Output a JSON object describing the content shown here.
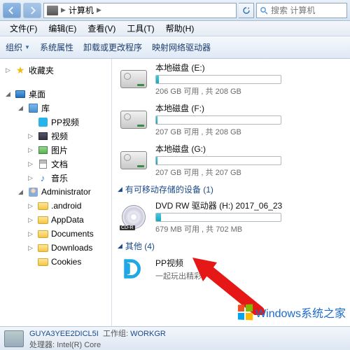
{
  "addressbar": {
    "location": "计算机",
    "sep": "▶"
  },
  "search": {
    "placeholder": "搜索 计算机"
  },
  "menu": {
    "file": "文件(F)",
    "edit": "编辑(E)",
    "view": "查看(V)",
    "tools": "工具(T)",
    "help": "帮助(H)"
  },
  "toolbar": {
    "organize": "组织",
    "properties": "系统属性",
    "uninstall": "卸载或更改程序",
    "mapnet": "映射网络驱动器"
  },
  "sidebar": {
    "favorites": "收藏夹",
    "desktop": "桌面",
    "libraries": "库",
    "lib_pp": "PP视频",
    "lib_video": "视频",
    "lib_pictures": "图片",
    "lib_docs": "文档",
    "lib_music": "音乐",
    "admin": "Administrator",
    "android": ".android",
    "appdata": "AppData",
    "documents": "Documents",
    "downloads": "Downloads",
    "cookies": "Cookies"
  },
  "drives": {
    "e": {
      "name": "本地磁盘 (E:)",
      "free": "206 GB 可用 , 共 208 GB",
      "fill": 2
    },
    "f": {
      "name": "本地磁盘 (F:)",
      "free": "207 GB 可用 , 共 208 GB",
      "fill": 1
    },
    "g": {
      "name": "本地磁盘 (G:)",
      "free": "207 GB 可用 , 共 207 GB",
      "fill": 1
    }
  },
  "groups": {
    "removable": "有可移动存储的设备 (1)",
    "other": "其他 (4)"
  },
  "dvd": {
    "name": "DVD RW 驱动器 (H:) 2017_06_23",
    "label": "CD-R",
    "free": "679 MB 可用 , 共 702 MB",
    "fill": 4
  },
  "pp": {
    "name": "PP视频",
    "sub": "一起玩出精彩"
  },
  "status": {
    "name": "GUYA3YEE2DICL5I",
    "wg_label": "工作组:",
    "wg": "WORKGR",
    "cpu_label": "处理器:",
    "cpu": "Intel(R) Core"
  },
  "watermark": "Windows系统之家"
}
